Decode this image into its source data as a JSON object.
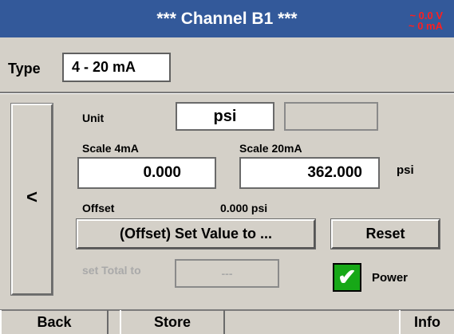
{
  "header": {
    "title": "***  Channel B1  ***",
    "status_voltage": "~ 0.0 V",
    "status_current": "~ 0 mA",
    "bg_color": "#33599a",
    "status_color": "#ff1e1e"
  },
  "type": {
    "label": "Type",
    "value": "4 - 20 mA"
  },
  "nav": {
    "back_arrow_label": "<"
  },
  "unit": {
    "label": "Unit",
    "value": "psi",
    "secondary_value": ""
  },
  "scale": {
    "min_label": "Scale 4mA",
    "min_value": "0.000",
    "max_label": "Scale 20mA",
    "max_value": "362.000",
    "unit": "psi"
  },
  "offset": {
    "label": "Offset",
    "value": "0.000 psi",
    "set_button_label": "(Offset) Set Value to ...",
    "reset_button_label": "Reset"
  },
  "total": {
    "label": "set Total to",
    "value": "---"
  },
  "power": {
    "label": "Power",
    "checked": true,
    "check_glyph": "✔",
    "check_color": "#17a817"
  },
  "footer": {
    "back_label": "Back",
    "store_label": "Store",
    "info_label": "Info"
  }
}
